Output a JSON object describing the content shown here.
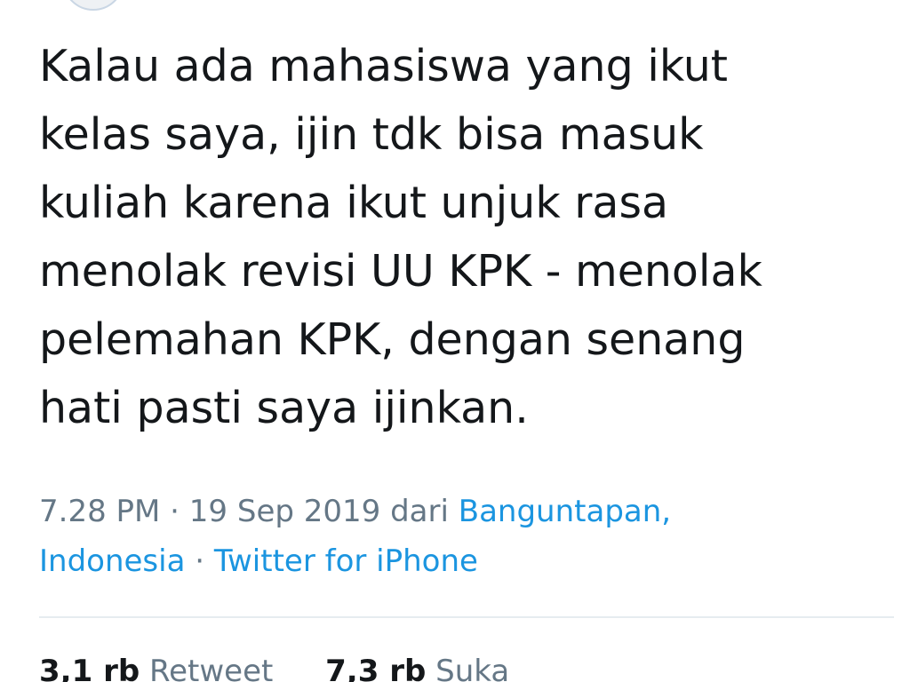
{
  "tweet": {
    "lines": [
      "Kalau ada mahasiswa yang ikut",
      "kelas saya, ijin tdk bisa masuk",
      "kuliah karena ikut unjuk rasa",
      "menolak revisi UU KPK - menolak",
      "pelemahan KPK, dengan senang",
      "hati pasti saya ijinkan."
    ]
  },
  "meta": {
    "time": "7.28 PM",
    "sep1": " · ",
    "date": "19 Sep 2019",
    "from": " dari ",
    "location_part1": "Banguntapan,",
    "location_part2": "Indonesia",
    "sep2": " · ",
    "source": "Twitter for iPhone"
  },
  "stats": {
    "retweet_count": "3,1 rb",
    "retweet_label": "Retweet",
    "like_count": "7,3 rb",
    "like_label": "Suka"
  },
  "colors": {
    "text": "#14171a",
    "muted": "#657786",
    "link": "#1b95e0"
  }
}
